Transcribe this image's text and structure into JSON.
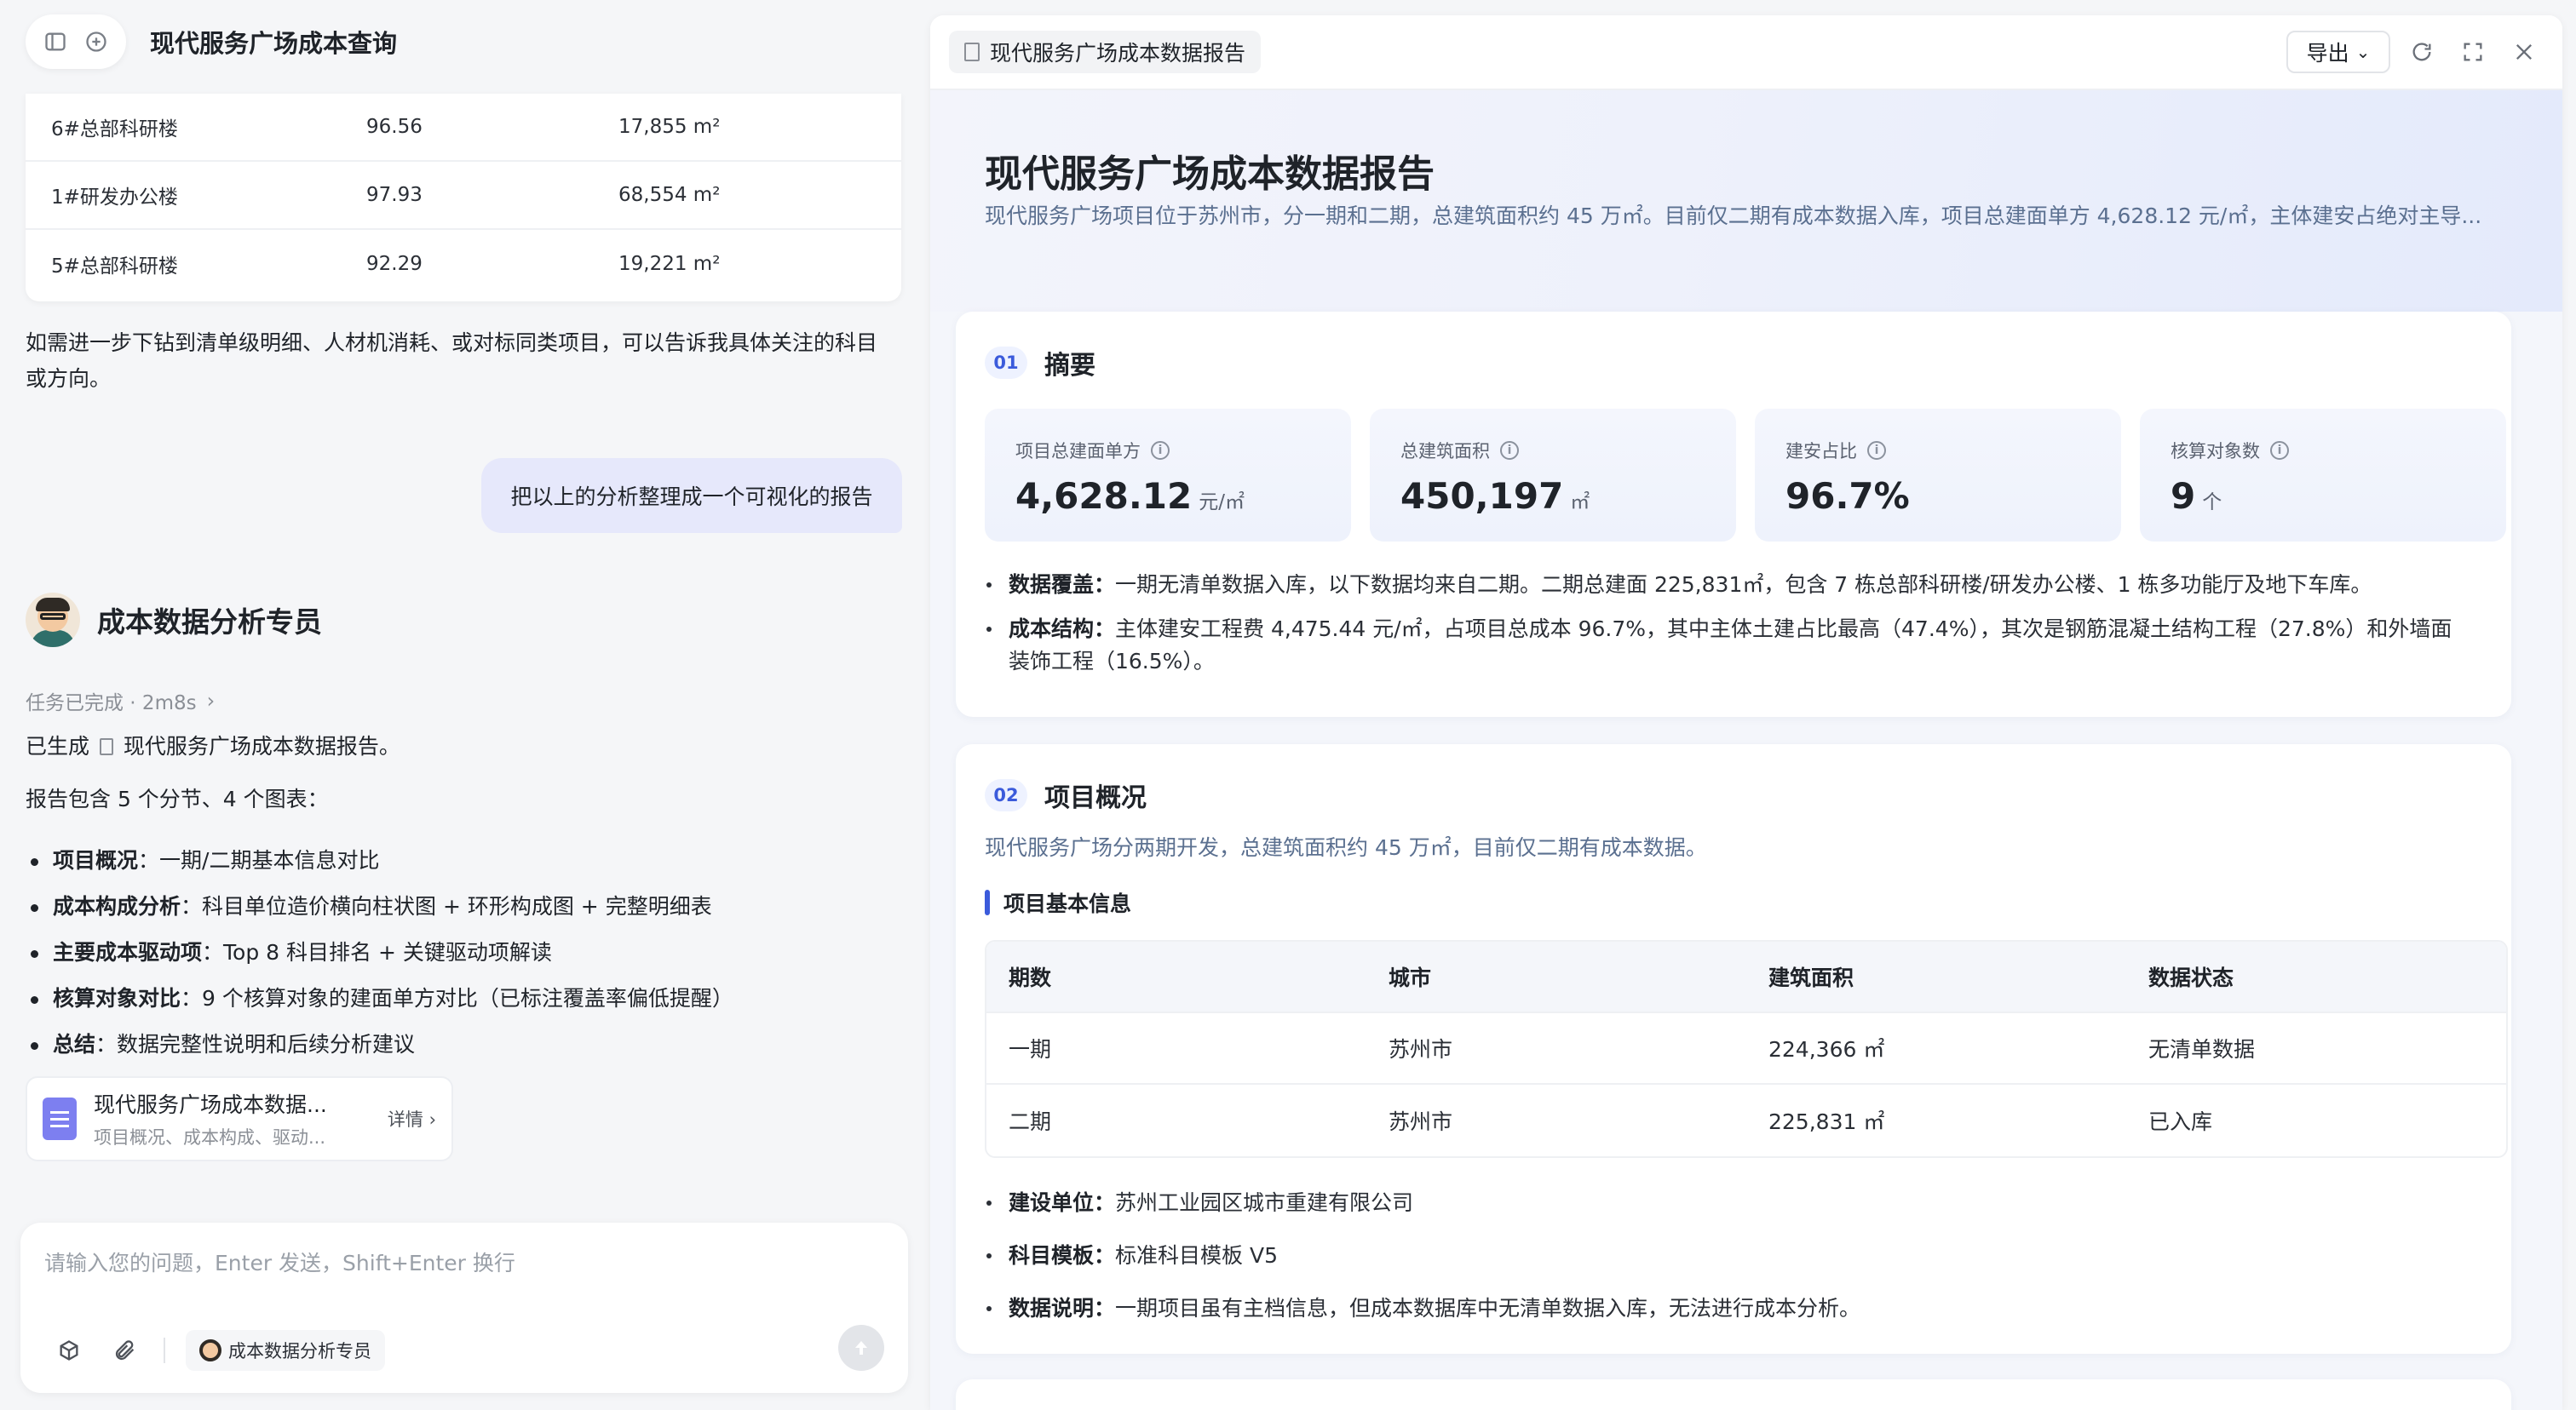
{
  "chat": {
    "title": "现代服务广场成本查询",
    "top_table": [
      {
        "name": "6#总部科研楼",
        "value": "96.56",
        "area": "17,855 m²"
      },
      {
        "name": "1#研发办公楼",
        "value": "97.93",
        "area": "68,554 m²"
      },
      {
        "name": "5#总部科研楼",
        "value": "92.29",
        "area": "19,221 m²"
      }
    ],
    "assistant_followup_line1": "如需进一步下钻到清单级明细、人材机消耗、或对标同类项目，可以告诉我具体关注的科目",
    "assistant_followup_line2": "或方向。",
    "user_message": "把以上的分析整理成一个可视化的报告",
    "agent_name": "成本数据分析专员",
    "task_status": "任务已完成 · 2m8s",
    "generated_prefix": "已生成",
    "generated_doc": "现代服务广场成本数据报告。",
    "report_contains": "报告包含 5 个分节、4 个图表：",
    "bullets": [
      {
        "bold": "项目概况",
        "text": "：一期/二期基本信息对比"
      },
      {
        "bold": "成本构成分析",
        "text": "：科目单位造价横向柱状图 + 环形构成图 + 完整明细表"
      },
      {
        "bold": "主要成本驱动项",
        "text": "：Top 8 科目排名 + 关键驱动项解读"
      },
      {
        "bold": "核算对象对比",
        "text": "：9 个核算对象的建面单方对比（已标注覆盖率偏低提醒）"
      },
      {
        "bold": "总结",
        "text": "：数据完整性说明和后续分析建议"
      }
    ],
    "file_card": {
      "title": "现代服务广场成本数据...",
      "subtitle": "项目概况、成本构成、驱动...",
      "detail": "详情 ›"
    },
    "input_placeholder": "请输入您的问题，Enter 发送，Shift+Enter 换行",
    "agent_chip": "成本数据分析专员"
  },
  "report": {
    "tab_label": "现代服务广场成本数据报告",
    "export_label": "导出",
    "title": "现代服务广场成本数据报告",
    "subtitle": "现代服务广场项目位于苏州市，分一期和二期，总建筑面积约 45 万㎡。目前仅二期有成本数据入库，项目总建面单方 4,628.12 元/㎡，主体建安占绝对主导...",
    "s1": {
      "num": "01",
      "title": "摘要",
      "kpis": [
        {
          "label": "项目总建面单方",
          "value": "4,628.12",
          "unit": "元/㎡"
        },
        {
          "label": "总建筑面积",
          "value": "450,197",
          "unit": "㎡"
        },
        {
          "label": "建安占比",
          "value": "96.7%",
          "unit": ""
        },
        {
          "label": "核算对象数",
          "value": "9",
          "unit": "个"
        }
      ],
      "points": [
        {
          "bold": "数据覆盖：",
          "text": "一期无清单数据入库，以下数据均来自二期。二期总建面 225,831㎡，包含 7 栋总部科研楼/研发办公楼、1 栋多功能厅及地下车库。"
        },
        {
          "bold": "成本结构：",
          "text": "主体建安工程费 4,475.44 元/㎡，占项目总成本 96.7%，其中主体土建占比最高（47.4%），其次是钢筋混凝土结构工程（27.8%）和外墙面",
          "text2": "装饰工程（16.5%）。"
        }
      ]
    },
    "s2": {
      "num": "02",
      "title": "项目概况",
      "desc": "现代服务广场分两期开发，总建筑面积约 45 万㎡，目前仅二期有成本数据。",
      "subhead": "项目基本信息",
      "headers": [
        "期数",
        "城市",
        "建筑面积",
        "数据状态"
      ],
      "rows": [
        [
          "一期",
          "苏州市",
          "224,366 ㎡",
          "无清单数据"
        ],
        [
          "二期",
          "苏州市",
          "225,831 ㎡",
          "已入库"
        ]
      ],
      "points": [
        {
          "bold": "建设单位：",
          "text": "苏州工业园区城市重建有限公司"
        },
        {
          "bold": "科目模板：",
          "text": "标准科目模板 V5"
        },
        {
          "bold": "数据说明：",
          "text": "一期项目虽有主档信息，但成本数据库中无清单数据入库，无法进行成本分析。"
        }
      ]
    }
  }
}
